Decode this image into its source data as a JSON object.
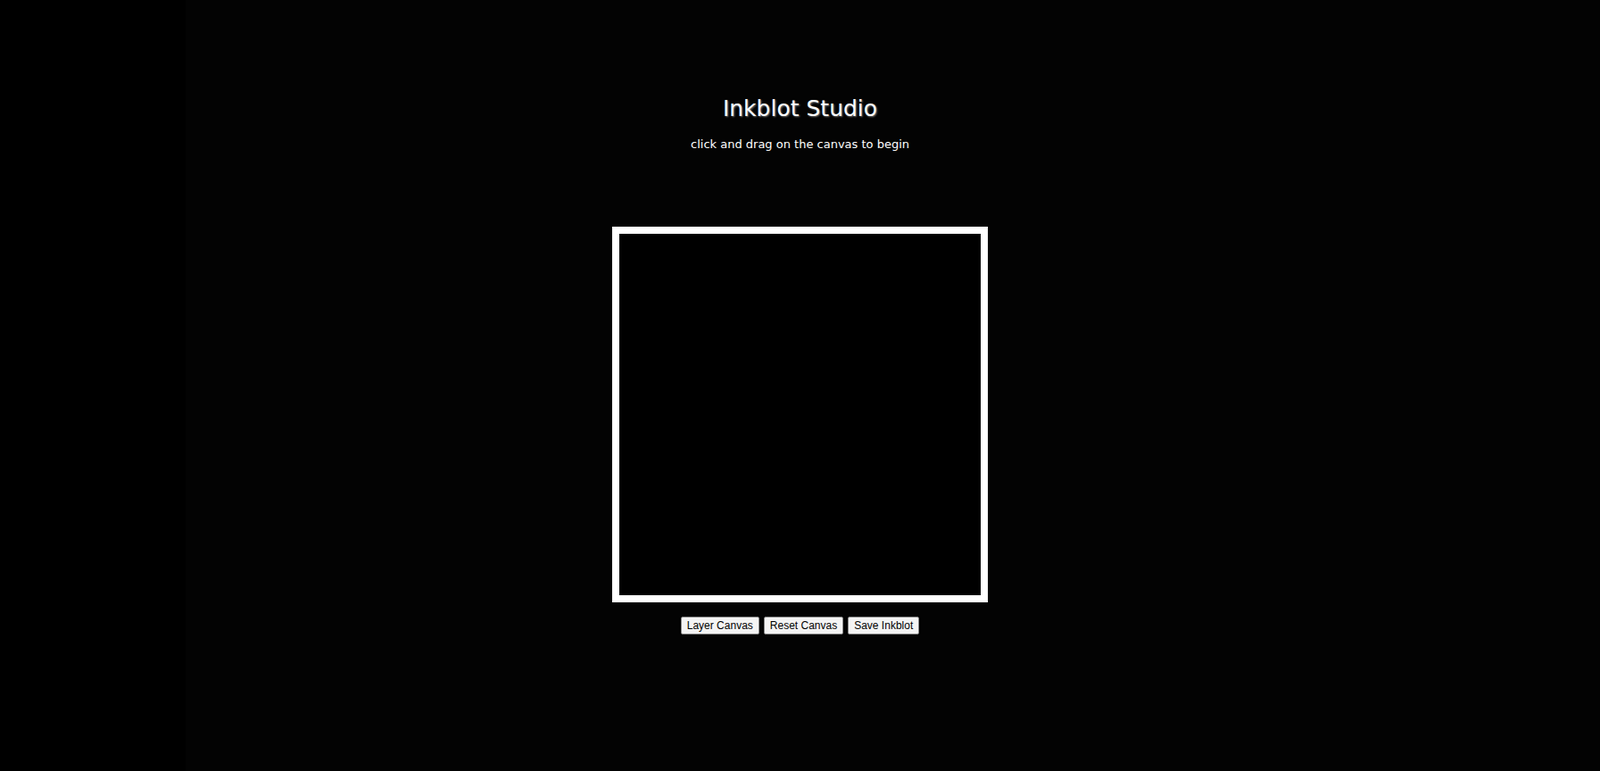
{
  "title": "Inkblot Studio",
  "instruction": "click and drag on the canvas to begin",
  "buttons": [
    "Layer Canvas",
    "Reset Canvas",
    "Save Inkblot"
  ]
}
